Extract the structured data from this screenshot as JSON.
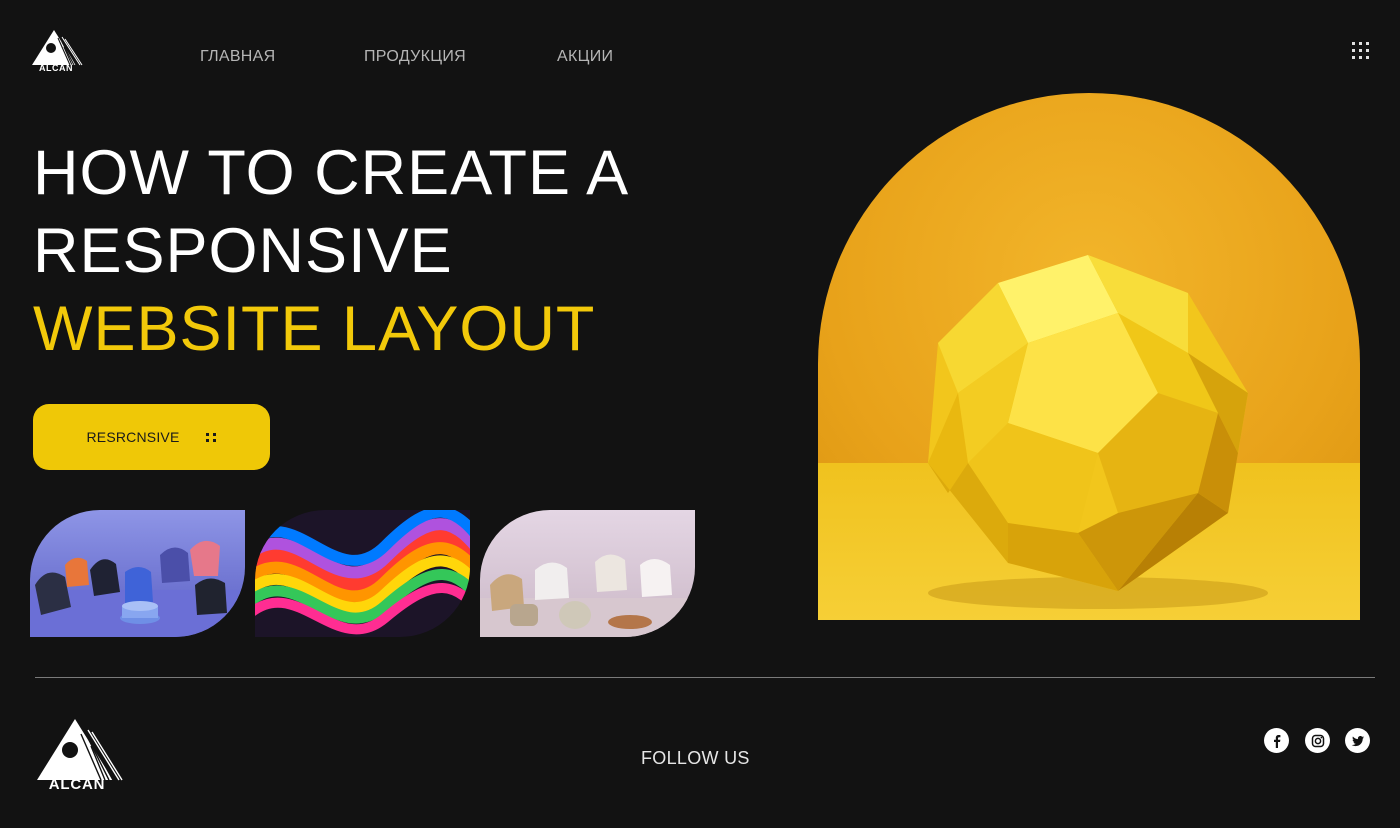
{
  "header": {
    "logo_text": "ALCAN",
    "nav": [
      {
        "label": "ГЛАВНАЯ"
      },
      {
        "label": "ПРОДУКЦИЯ"
      },
      {
        "label": "АКЦИИ"
      }
    ],
    "menu_icon": "grid-dots-icon"
  },
  "hero": {
    "title_line1": "HOW TO CREATE A",
    "title_line2": "RESPONSIVE",
    "title_line3": "WEBSITE LAYOUT",
    "cta_label": "RESRCNSIVE",
    "cta_icon": "four-dots-icon"
  },
  "gallery": {
    "items": [
      {
        "subject": "colorful chairs"
      },
      {
        "subject": "rainbow swirl"
      },
      {
        "subject": "white chairs"
      }
    ]
  },
  "feature": {
    "subject": "yellow geometric sphere"
  },
  "footer": {
    "logo_text": "ALCAN",
    "follow_label": "FOLLOW US",
    "social": [
      {
        "icon": "facebook-icon"
      },
      {
        "icon": "instagram-icon"
      },
      {
        "icon": "twitter-icon"
      }
    ]
  },
  "colors": {
    "background": "#121212",
    "accent": "#efc807",
    "text": "#ffffff",
    "nav_text": "#b5b5b5"
  }
}
